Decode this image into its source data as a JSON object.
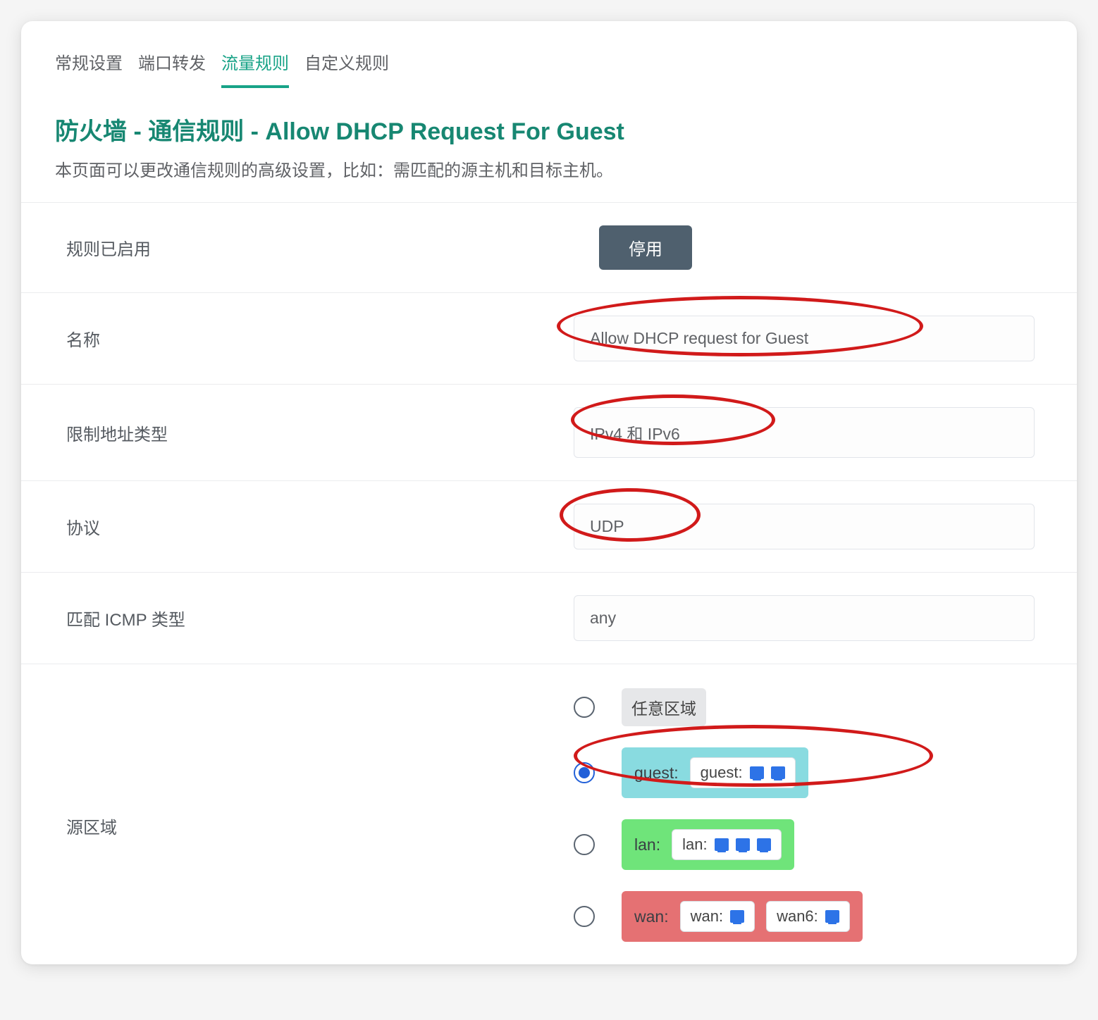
{
  "tabs": [
    {
      "label": "常规设置",
      "active": false
    },
    {
      "label": "端口转发",
      "active": false
    },
    {
      "label": "流量规则",
      "active": true
    },
    {
      "label": "自定义规则",
      "active": false
    }
  ],
  "title": "防火墙 - 通信规则 - Allow DHCP Request For Guest",
  "subtitle": "本页面可以更改通信规则的高级设置，比如：需匹配的源主机和目标主机。",
  "form": {
    "enabled_label": "规则已启用",
    "disable_button": "停用",
    "name_label": "名称",
    "name_value": "Allow DHCP request for Guest",
    "restrict_label": "限制地址类型",
    "restrict_value": "IPv4 和 IPv6",
    "proto_label": "协议",
    "proto_value": "UDP",
    "icmp_label": "匹配 ICMP 类型",
    "icmp_value": "any",
    "src_zone_label": "源区域",
    "any_zone_label": "任意区域",
    "zones": {
      "guest": {
        "title": "guest:",
        "ifaces": [
          {
            "name": "guest:",
            "icons": 2
          }
        ]
      },
      "lan": {
        "title": "lan:",
        "ifaces": [
          {
            "name": "lan:",
            "icons": 3
          }
        ]
      },
      "wan": {
        "title": "wan:",
        "ifaces": [
          {
            "name": "wan:",
            "icons": 1
          },
          {
            "name": "wan6:",
            "icons": 1
          }
        ]
      }
    },
    "selected_zone": "guest"
  }
}
